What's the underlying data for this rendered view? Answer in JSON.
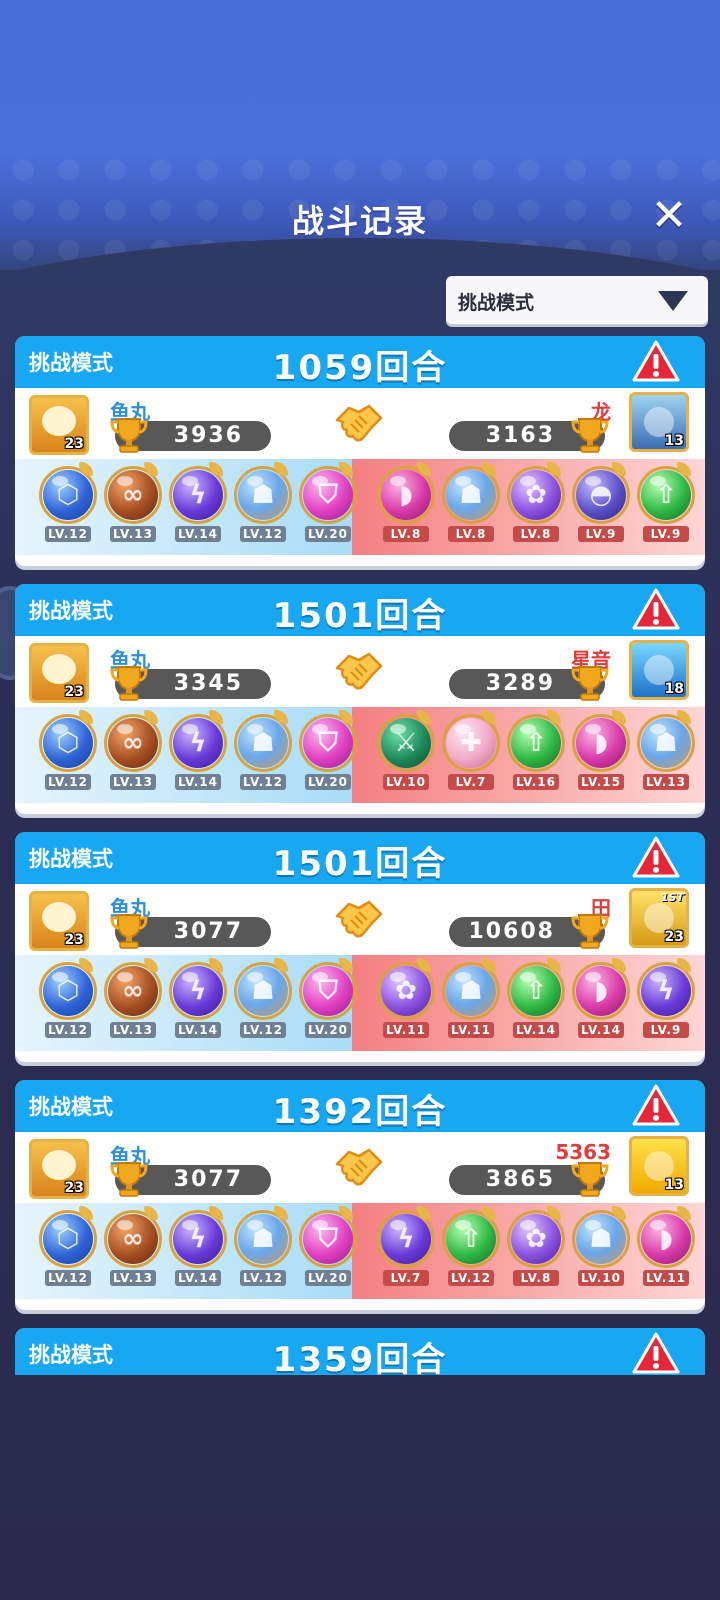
{
  "header": {
    "title": "战斗记录",
    "close": "✕"
  },
  "filter": {
    "selected": "挑战模式"
  },
  "records": [
    {
      "mode": "挑战模式",
      "rounds": "1059回合",
      "left": {
        "name": "鱼丸",
        "score": "3936",
        "level": "23",
        "avatar": "tiger"
      },
      "right": {
        "name": "龙",
        "score": "3163",
        "level": "13",
        "avatar": "warrior"
      },
      "left_pets": [
        {
          "orb": "blue-hex",
          "lv": "LV.12"
        },
        {
          "orb": "brown-infinity",
          "lv": "LV.13"
        },
        {
          "orb": "purple-lightning",
          "lv": "LV.14"
        },
        {
          "orb": "blue-figures",
          "lv": "LV.12"
        },
        {
          "orb": "pink-shield",
          "lv": "LV.20"
        }
      ],
      "right_pets": [
        {
          "orb": "pink-drop",
          "lv": "LV.8"
        },
        {
          "orb": "blue-figures",
          "lv": "LV.8"
        },
        {
          "orb": "purple-swirl",
          "lv": "LV.8"
        },
        {
          "orb": "purple-ghost",
          "lv": "LV.9"
        },
        {
          "orb": "green-arrow",
          "lv": "LV.9"
        }
      ]
    },
    {
      "mode": "挑战模式",
      "rounds": "1501回合",
      "left": {
        "name": "鱼丸",
        "score": "3345",
        "level": "23",
        "avatar": "tiger"
      },
      "right": {
        "name": "星音",
        "score": "3289",
        "level": "18",
        "avatar": "wave"
      },
      "left_pets": [
        {
          "orb": "blue-hex",
          "lv": "LV.12"
        },
        {
          "orb": "brown-infinity",
          "lv": "LV.13"
        },
        {
          "orb": "purple-lightning",
          "lv": "LV.14"
        },
        {
          "orb": "blue-figures",
          "lv": "LV.12"
        },
        {
          "orb": "pink-shield",
          "lv": "LV.20"
        }
      ],
      "right_pets": [
        {
          "orb": "green-dark",
          "lv": "LV.10"
        },
        {
          "orb": "pink-light",
          "lv": "LV.7"
        },
        {
          "orb": "green-arrow",
          "lv": "LV.16"
        },
        {
          "orb": "pink-drop",
          "lv": "LV.15"
        },
        {
          "orb": "blue-figures",
          "lv": "LV.13"
        }
      ]
    },
    {
      "mode": "挑战模式",
      "rounds": "1501回合",
      "left": {
        "name": "鱼丸",
        "score": "3077",
        "level": "23",
        "avatar": "tiger"
      },
      "right": {
        "name": "田",
        "score": "10608",
        "level": "23",
        "avatar": "golden",
        "badge": "1ST"
      },
      "left_pets": [
        {
          "orb": "blue-hex",
          "lv": "LV.12"
        },
        {
          "orb": "brown-infinity",
          "lv": "LV.13"
        },
        {
          "orb": "purple-lightning",
          "lv": "LV.14"
        },
        {
          "orb": "blue-figures",
          "lv": "LV.12"
        },
        {
          "orb": "pink-shield",
          "lv": "LV.20"
        }
      ],
      "right_pets": [
        {
          "orb": "purple-swirl",
          "lv": "LV.11"
        },
        {
          "orb": "blue-figures",
          "lv": "LV.11"
        },
        {
          "orb": "green-arrow",
          "lv": "LV.14"
        },
        {
          "orb": "pink-drop",
          "lv": "LV.14"
        },
        {
          "orb": "purple-lightning",
          "lv": "LV.9"
        }
      ]
    },
    {
      "mode": "挑战模式",
      "rounds": "1392回合",
      "left": {
        "name": "鱼丸",
        "score": "3077",
        "level": "23",
        "avatar": "tiger"
      },
      "right": {
        "name": "5363",
        "score": "3865",
        "level": "13",
        "avatar": "yellow"
      },
      "left_pets": [
        {
          "orb": "blue-hex",
          "lv": "LV.12"
        },
        {
          "orb": "brown-infinity",
          "lv": "LV.13"
        },
        {
          "orb": "purple-lightning",
          "lv": "LV.14"
        },
        {
          "orb": "blue-figures",
          "lv": "LV.12"
        },
        {
          "orb": "pink-shield",
          "lv": "LV.20"
        }
      ],
      "right_pets": [
        {
          "orb": "purple-lightning",
          "lv": "LV.7"
        },
        {
          "orb": "green-arrow",
          "lv": "LV.12"
        },
        {
          "orb": "purple-swirl",
          "lv": "LV.8"
        },
        {
          "orb": "blue-figures",
          "lv": "LV.10"
        },
        {
          "orb": "pink-drop",
          "lv": "LV.11"
        }
      ]
    }
  ],
  "partial_record": {
    "mode": "挑战模式",
    "rounds": "1359回合"
  },
  "colors": {
    "header_blue": "#17a7f3",
    "left_name": "#2d8fd8",
    "right_name": "#e33b3b"
  }
}
